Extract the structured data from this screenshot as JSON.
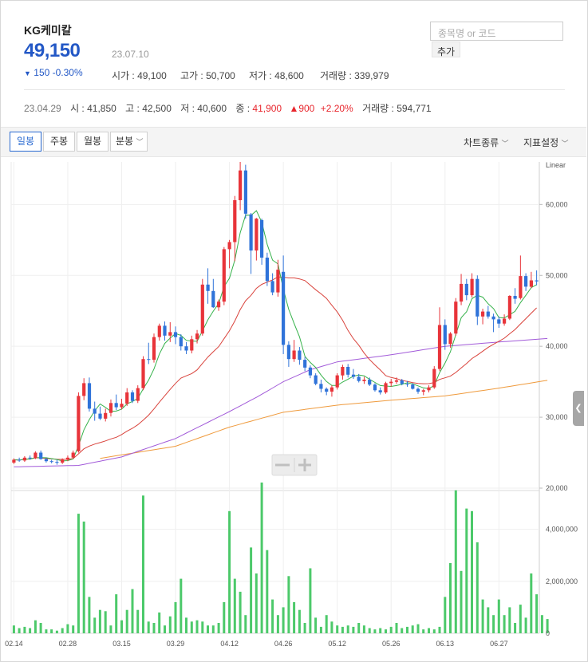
{
  "header": {
    "stock_name": "KG케미칼",
    "price": "49,150",
    "price_date": "23.07.10",
    "change_arrow": "▼",
    "change_text": "150 -0.30%",
    "open": "시가 : 49,100",
    "high": "고가 : 50,700",
    "low": "저가 : 48,600",
    "volume": "거래량 : 339,979"
  },
  "search": {
    "placeholder": "종목명 or 코드",
    "add_label": "추가"
  },
  "prev_day": {
    "date": "23.04.29",
    "open": "시 : 41,850",
    "high": "고 : 42,500",
    "low": "저 : 40,600",
    "close_label": "종 : ",
    "close_value": "41,900",
    "change_value": "▲900",
    "change_pct": "+2.20%",
    "volume": "거래량 : 594,771"
  },
  "toolbar": {
    "periods": [
      "일봉",
      "주봉",
      "월봉",
      "분봉"
    ],
    "active_period": "일봉",
    "chart_type_label": "차트종류",
    "indicator_label": "지표설정"
  },
  "colors": {
    "up": "#e8343a",
    "down": "#2f73d9",
    "ma5": "#35b24a",
    "ma20": "#d9433c",
    "ma60": "#a25bd9",
    "ma120": "#ef9a3c",
    "volume": "#4cc96a",
    "accent": "#2a6ad1"
  },
  "chart_data": {
    "type": "candlestick",
    "price_axis": {
      "scale": "Linear",
      "ticks": [
        20000,
        30000,
        40000,
        50000,
        60000
      ],
      "tick_labels": [
        "20,000",
        "30,000",
        "40,000",
        "50,000",
        "60,000"
      ],
      "ylim": [
        20000,
        66000
      ]
    },
    "volume_axis": {
      "ticks": [
        0,
        2000000,
        4000000
      ],
      "tick_labels": [
        "0",
        "2,000,000",
        "4,000,000"
      ],
      "ylim": [
        0,
        5400000
      ]
    },
    "x_tick_labels": [
      "02.14",
      "02.28",
      "03.15",
      "03.29",
      "04.12",
      "04.26",
      "05.12",
      "05.26",
      "06.13",
      "06.27"
    ],
    "x_tick_index": [
      0,
      10,
      20,
      30,
      40,
      50,
      60,
      70,
      80,
      90
    ],
    "candles": [
      [
        23600,
        24200,
        23400,
        24000
      ],
      [
        24000,
        24300,
        23700,
        23900
      ],
      [
        23900,
        24500,
        23700,
        24300
      ],
      [
        24300,
        24600,
        24000,
        24200
      ],
      [
        24200,
        25200,
        24100,
        25000
      ],
      [
        25000,
        25300,
        24000,
        24100
      ],
      [
        24100,
        24300,
        23600,
        23800
      ],
      [
        23800,
        24000,
        23500,
        23700
      ],
      [
        23700,
        24000,
        23300,
        23600
      ],
      [
        23600,
        24200,
        23400,
        24000
      ],
      [
        24000,
        24600,
        23800,
        24300
      ],
      [
        24300,
        25300,
        24100,
        25000
      ],
      [
        25200,
        33500,
        25000,
        33000
      ],
      [
        33000,
        35500,
        32400,
        34800
      ],
      [
        34800,
        35600,
        30800,
        31200
      ],
      [
        31200,
        32200,
        29500,
        30500
      ],
      [
        30500,
        31500,
        29600,
        29800
      ],
      [
        29800,
        31200,
        29400,
        30600
      ],
      [
        30600,
        32500,
        30100,
        32000
      ],
      [
        32000,
        33200,
        31000,
        31400
      ],
      [
        31400,
        32600,
        31100,
        31900
      ],
      [
        31900,
        34100,
        31600,
        33500
      ],
      [
        33500,
        33800,
        32000,
        32300
      ],
      [
        32300,
        34500,
        32000,
        34100
      ],
      [
        34100,
        38600,
        33800,
        38200
      ],
      [
        38200,
        40500,
        37500,
        38100
      ],
      [
        38100,
        41800,
        37700,
        41300
      ],
      [
        41300,
        43200,
        40800,
        42900
      ],
      [
        42900,
        43500,
        40800,
        41500
      ],
      [
        41500,
        43400,
        40600,
        42000
      ],
      [
        42000,
        42800,
        40300,
        41300
      ],
      [
        41300,
        41700,
        39400,
        40000
      ],
      [
        40000,
        40600,
        38900,
        39400
      ],
      [
        39400,
        41500,
        39000,
        41000
      ],
      [
        41000,
        42300,
        40400,
        41800
      ],
      [
        41800,
        49500,
        41500,
        48700
      ],
      [
        48700,
        51000,
        46000,
        47800
      ],
      [
        47800,
        49500,
        45400,
        45500
      ],
      [
        45500,
        46600,
        45000,
        46300
      ],
      [
        46300,
        54000,
        45800,
        53700
      ],
      [
        53700,
        55000,
        51000,
        54700
      ],
      [
        54700,
        61200,
        52000,
        60600
      ],
      [
        60600,
        66000,
        59200,
        64800
      ],
      [
        64800,
        65600,
        58000,
        58700
      ],
      [
        58600,
        58800,
        50200,
        53500
      ],
      [
        53500,
        58100,
        52100,
        58000
      ],
      [
        57800,
        58000,
        51500,
        52500
      ],
      [
        52500,
        53200,
        48500,
        49200
      ],
      [
        49200,
        50300,
        47200,
        47600
      ],
      [
        47600,
        52200,
        47000,
        50800
      ],
      [
        50500,
        52800,
        38900,
        40200
      ],
      [
        40200,
        40700,
        37100,
        38200
      ],
      [
        38200,
        40900,
        37800,
        39400
      ],
      [
        39400,
        39900,
        37400,
        38100
      ],
      [
        38100,
        38500,
        36500,
        37000
      ],
      [
        37000,
        37300,
        35500,
        35900
      ],
      [
        35900,
        36200,
        34500,
        34700
      ],
      [
        34700,
        35300,
        33500,
        34000
      ],
      [
        34000,
        34200,
        33100,
        33600
      ],
      [
        33600,
        34500,
        32900,
        34200
      ],
      [
        34200,
        36200,
        33900,
        35900
      ],
      [
        35900,
        37400,
        35300,
        37100
      ],
      [
        37100,
        37500,
        35600,
        36000
      ],
      [
        36000,
        36800,
        35400,
        35700
      ],
      [
        35700,
        36100,
        34900,
        35100
      ],
      [
        35100,
        35700,
        34700,
        35300
      ],
      [
        35300,
        35600,
        34400,
        34600
      ],
      [
        34600,
        34800,
        33600,
        33800
      ],
      [
        33800,
        34200,
        33200,
        33500
      ],
      [
        33500,
        35000,
        33300,
        34800
      ],
      [
        34800,
        35400,
        34300,
        35000
      ],
      [
        35000,
        35600,
        34700,
        35200
      ],
      [
        35200,
        35400,
        34500,
        34700
      ],
      [
        34700,
        35100,
        34300,
        34600
      ],
      [
        34600,
        34800,
        33900,
        34000
      ],
      [
        34000,
        34200,
        33300,
        33600
      ],
      [
        33600,
        34000,
        33100,
        33800
      ],
      [
        33800,
        34500,
        33500,
        34200
      ],
      [
        34200,
        37200,
        34000,
        36800
      ],
      [
        36800,
        45500,
        36500,
        43000
      ],
      [
        43000,
        43800,
        39500,
        40300
      ],
      [
        40300,
        42000,
        39800,
        41800
      ],
      [
        41800,
        46800,
        41500,
        46300
      ],
      [
        46300,
        50200,
        45800,
        48800
      ],
      [
        48800,
        49500,
        46500,
        47200
      ],
      [
        47200,
        50300,
        46900,
        49500
      ],
      [
        49500,
        50000,
        43000,
        44200
      ],
      [
        44200,
        45300,
        43100,
        44900
      ],
      [
        44900,
        45700,
        43900,
        44200
      ],
      [
        44200,
        44600,
        42000,
        43800
      ],
      [
        43800,
        44200,
        42600,
        43200
      ],
      [
        43200,
        44500,
        42900,
        43900
      ],
      [
        43900,
        47200,
        43700,
        47100
      ],
      [
        47100,
        48200,
        46000,
        46700
      ],
      [
        46800,
        52800,
        46600,
        49900
      ],
      [
        49900,
        50300,
        47800,
        48400
      ],
      [
        48400,
        50500,
        48200,
        49300
      ],
      [
        49300,
        50700,
        48600,
        49150
      ]
    ],
    "volumes": [
      300000,
      200000,
      250000,
      200000,
      500000,
      400000,
      150000,
      150000,
      100000,
      200000,
      350000,
      300000,
      4600000,
      4300000,
      1400000,
      600000,
      900000,
      850000,
      300000,
      1500000,
      500000,
      900000,
      1700000,
      900000,
      5300000,
      450000,
      400000,
      800000,
      300000,
      650000,
      1200000,
      2100000,
      600000,
      450000,
      500000,
      450000,
      300000,
      300000,
      400000,
      1200000,
      4700000,
      2100000,
      1600000,
      700000,
      3300000,
      2300000,
      5800000,
      3200000,
      1300000,
      700000,
      1000000,
      2200000,
      1200000,
      900000,
      400000,
      2500000,
      600000,
      250000,
      700000,
      450000,
      300000,
      250000,
      300000,
      250000,
      400000,
      300000,
      200000,
      150000,
      200000,
      150000,
      250000,
      400000,
      200000,
      250000,
      300000,
      350000,
      150000,
      200000,
      150000,
      250000,
      1400000,
      2700000,
      5500000,
      2400000,
      4800000,
      4700000,
      3500000,
      1300000,
      1000000,
      700000,
      1300000,
      700000,
      1000000,
      400000,
      1100000,
      600000,
      2300000,
      1500000,
      700000,
      550000
    ],
    "ma5_from_index": 4,
    "ma20_from_index": 19,
    "ma60_start_value": 23000,
    "ma60_start_index": 0,
    "ma120_start_index": 16,
    "ma120_values_anchor": [
      [
        16,
        24200
      ],
      [
        30,
        25900
      ],
      [
        40,
        28600
      ],
      [
        50,
        30700
      ],
      [
        60,
        31700
      ],
      [
        70,
        32400
      ],
      [
        80,
        33000
      ],
      [
        90,
        34100
      ],
      [
        99,
        35200
      ]
    ],
    "ma60_values_anchor": [
      [
        0,
        23000
      ],
      [
        12,
        23200
      ],
      [
        20,
        24400
      ],
      [
        30,
        27000
      ],
      [
        40,
        30800
      ],
      [
        45,
        32800
      ],
      [
        50,
        35000
      ],
      [
        55,
        36700
      ],
      [
        60,
        37800
      ],
      [
        70,
        38800
      ],
      [
        80,
        40000
      ],
      [
        90,
        40600
      ],
      [
        99,
        41100
      ]
    ]
  }
}
